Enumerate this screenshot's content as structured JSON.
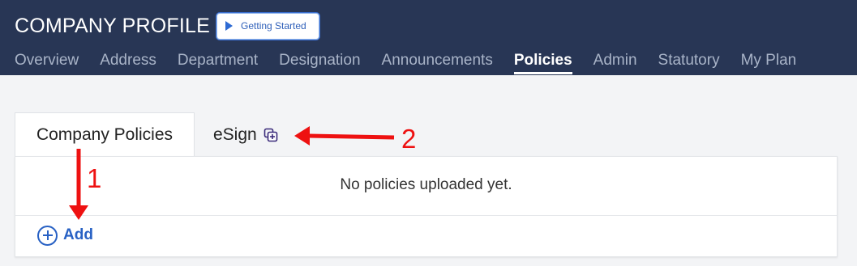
{
  "header": {
    "title": "COMPANY PROFILE",
    "getting_started_label": "Getting Started",
    "nav": [
      {
        "label": "Overview",
        "active": false
      },
      {
        "label": "Address",
        "active": false
      },
      {
        "label": "Department",
        "active": false
      },
      {
        "label": "Designation",
        "active": false
      },
      {
        "label": "Announcements",
        "active": false
      },
      {
        "label": "Policies",
        "active": true
      },
      {
        "label": "Admin",
        "active": false
      },
      {
        "label": "Statutory",
        "active": false
      },
      {
        "label": "My Plan",
        "active": false
      }
    ]
  },
  "tabs": {
    "company_policies": "Company Policies",
    "esign": "eSign",
    "esign_icon": "esign-stamp-icon"
  },
  "panel": {
    "empty_message": "No policies uploaded yet.",
    "add_label": "Add",
    "add_icon": "plus-circle-icon"
  },
  "annotations": {
    "marker_1": "1",
    "marker_2": "2",
    "color": "#ee1111"
  },
  "colors": {
    "header_bg": "#283655",
    "accent": "#2861c4"
  }
}
